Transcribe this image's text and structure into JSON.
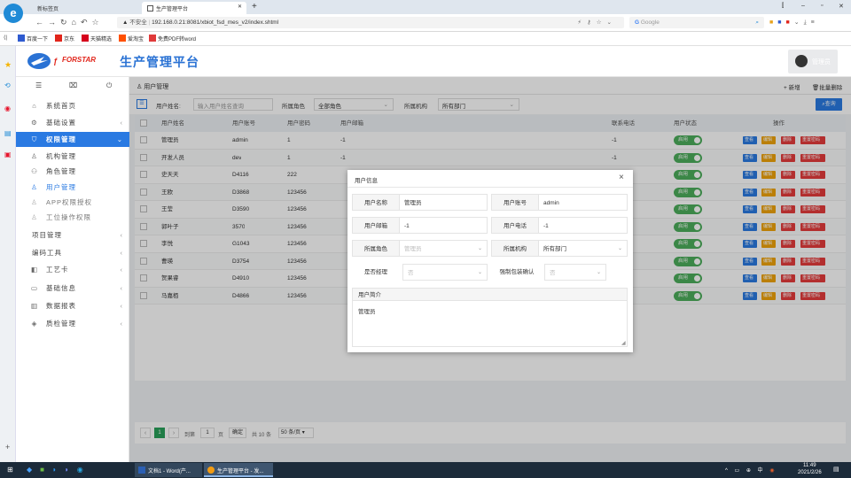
{
  "browser": {
    "tab1": "新标签页",
    "tab2": "生产管理平台",
    "new_tab": "+",
    "not_secure": "不安全",
    "url": "192.168.0.21:8081/xbiot_fsd_mes_v2/index.shtml",
    "search_engine": "Google",
    "window_controls": [
      "–",
      "▫",
      "✕"
    ]
  },
  "bookmarks": [
    {
      "label": "百度一下",
      "color": "#2f5bd0"
    },
    {
      "label": "京东",
      "color": "#e1251b"
    },
    {
      "label": "天猫精选",
      "color": "#d6001c"
    },
    {
      "label": "爱淘宝",
      "color": "#ff5000"
    },
    {
      "label": "免费PDF转word",
      "color": "#e03a3a"
    }
  ],
  "app": {
    "brand": "FORSTAR",
    "title": "生产管理平台",
    "user_name": "管理员"
  },
  "sidebar": {
    "top_icons": [
      "menu-icon",
      "bag-icon",
      "power-icon"
    ],
    "items": [
      {
        "label": "系统首页",
        "icon": "home-icon",
        "arrow": ""
      },
      {
        "label": "基础设置",
        "icon": "gear-icon",
        "arrow": "‹"
      },
      {
        "label": "权限管理",
        "icon": "shield-icon",
        "arrow": "⌄"
      },
      {
        "label": "机构管理",
        "icon": "org-icon",
        "arrow": ""
      },
      {
        "label": "角色管理",
        "icon": "role-icon",
        "arrow": ""
      },
      {
        "label": "用户管理",
        "icon": "user-icon",
        "arrow": ""
      },
      {
        "label": "APP权限授权",
        "icon": "user-icon",
        "arrow": ""
      },
      {
        "label": "工位操作权限",
        "icon": "user-icon",
        "arrow": ""
      },
      {
        "label": "项目管理",
        "icon": "",
        "arrow": "‹"
      },
      {
        "label": "编码工具",
        "icon": "",
        "arrow": "‹"
      },
      {
        "label": "工艺卡",
        "icon": "card-icon",
        "arrow": "‹"
      },
      {
        "label": "基础信息",
        "icon": "monitor-icon",
        "arrow": "‹"
      },
      {
        "label": "数据报表",
        "icon": "report-icon",
        "arrow": "‹"
      },
      {
        "label": "质检管理",
        "icon": "layers-icon",
        "arrow": "‹"
      }
    ]
  },
  "main": {
    "breadcrumb": "用户管理",
    "add_label": "新增",
    "batch_delete_label": "批量删除",
    "search": {
      "name_label": "用户姓名:",
      "name_placeholder": "输入用户姓名查询",
      "role_label": "所属角色",
      "role_value": "全部角色",
      "org_label": "所属机构",
      "org_value": "所有部门",
      "query_label": "查询"
    },
    "table": {
      "headers": [
        "用户姓名",
        "用户账号",
        "用户密码",
        "用户邮箱",
        "联系电话",
        "用户状态",
        "操作"
      ],
      "status_label": "启用",
      "actions": {
        "view": "查看",
        "edit": "编辑",
        "delete": "删除",
        "reset": "重置密码"
      },
      "rows": [
        {
          "name": "管理员",
          "account": "admin",
          "password": "1",
          "email": "-1",
          "phone": "-1"
        },
        {
          "name": "开发人员",
          "account": "dev",
          "password": "1",
          "email": "-1",
          "phone": "-1"
        },
        {
          "name": "史天天",
          "account": "D4116",
          "password": "222",
          "email": "",
          "phone": ""
        },
        {
          "name": "王欧",
          "account": "D3868",
          "password": "123456",
          "email": "",
          "phone": ""
        },
        {
          "name": "王莹",
          "account": "D3590",
          "password": "123456",
          "email": "",
          "phone": ""
        },
        {
          "name": "郭叶子",
          "account": "3570",
          "password": "123456",
          "email": "",
          "phone": ""
        },
        {
          "name": "李悦",
          "account": "G1043",
          "password": "123456",
          "email": "",
          "phone": ""
        },
        {
          "name": "曹瑛",
          "account": "D3754",
          "password": "123456",
          "email": "",
          "phone": ""
        },
        {
          "name": "贺果睿",
          "account": "D4910",
          "password": "123456",
          "email": "",
          "phone": ""
        },
        {
          "name": "马嘉栢",
          "account": "D4866",
          "password": "123456",
          "email": "",
          "phone": ""
        }
      ]
    },
    "pager": {
      "prev": "‹",
      "current_page": "1",
      "next": "›",
      "goto_label": "到第",
      "goto_value": "1",
      "page_unit": "页",
      "confirm": "确定",
      "total": "共 10 条",
      "page_size": "50 条/页"
    }
  },
  "modal": {
    "title": "用户信息",
    "close": "×",
    "name_label": "用户名称",
    "name_value": "管理员",
    "account_label": "用户账号",
    "account_value": "admin",
    "email_label": "用户邮箱",
    "email_value": "-1",
    "phone_label": "用户电话",
    "phone_value": "-1",
    "role_label": "所属角色",
    "role_value": "管理员",
    "org_label": "所属机构",
    "org_value": "所有部门",
    "manager_label": "是否经理",
    "manager_value": "否",
    "force_label": "强制包装确认",
    "force_value": "否",
    "intro_label": "用户简介",
    "intro_value": "管理员"
  },
  "taskbar": {
    "items": [
      "文档1 - Word(产...",
      "生产管理平台 - 发..."
    ],
    "ime": "中",
    "time": "11:49",
    "date": "2021/2/26"
  }
}
